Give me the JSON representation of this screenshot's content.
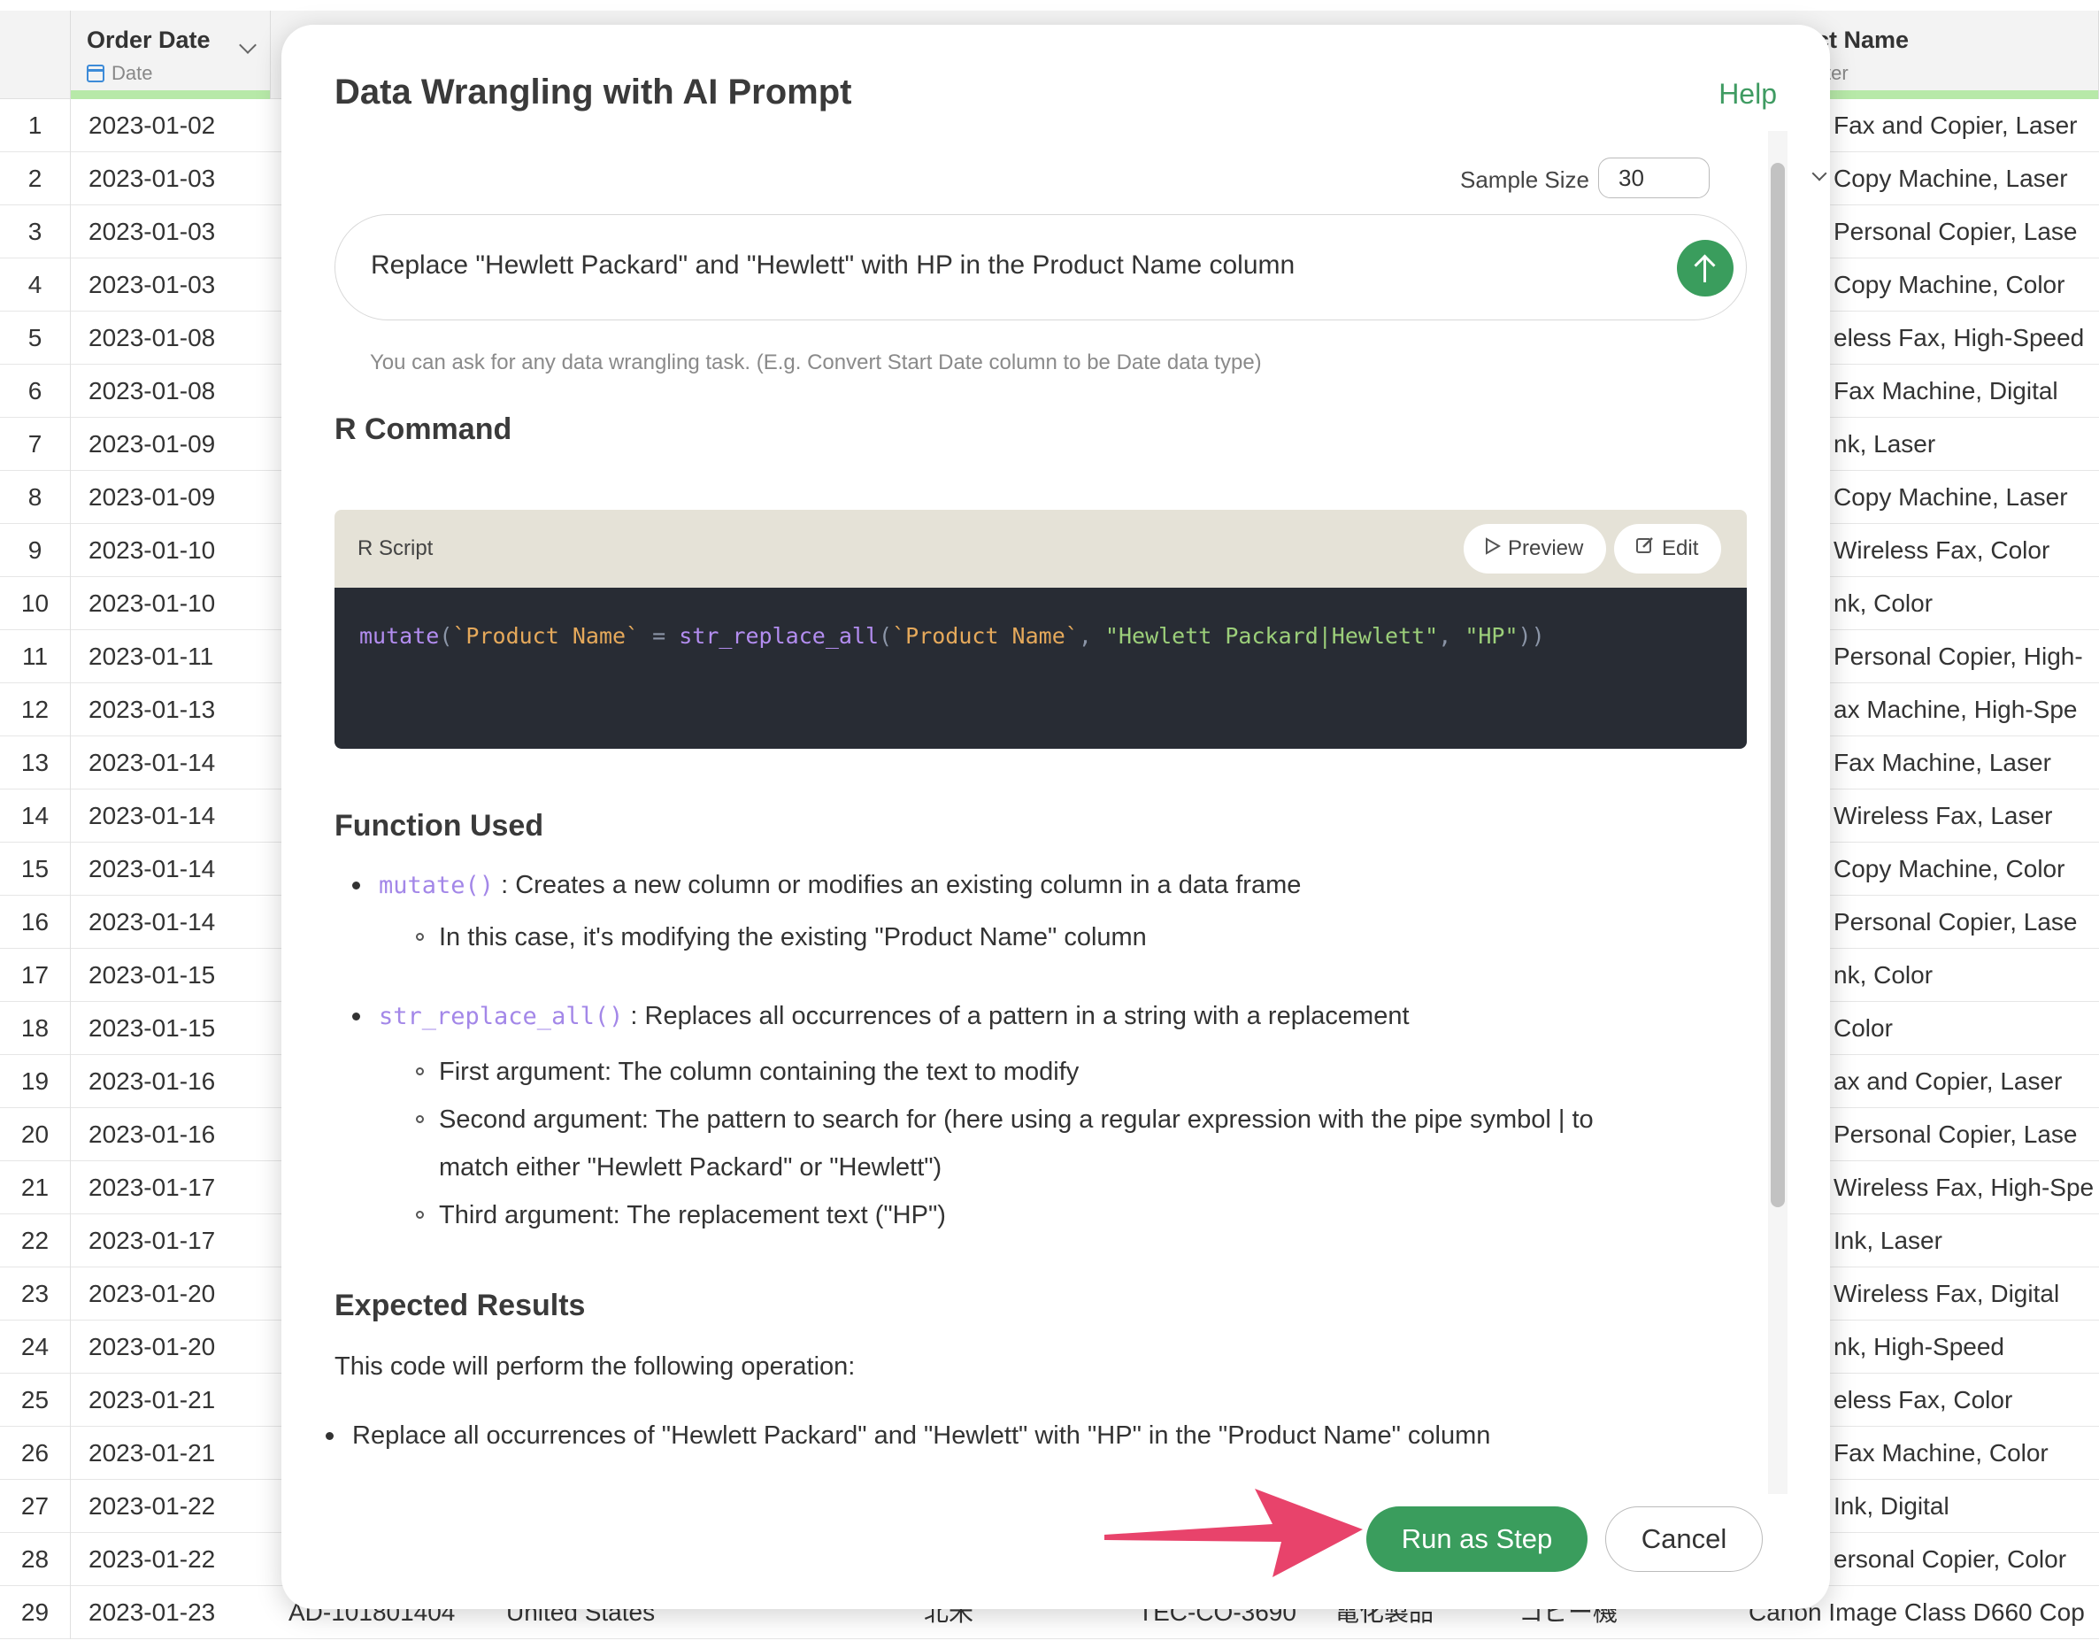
{
  "grid": {
    "columns": [
      {
        "title": "Order Date",
        "subtitle": "Date"
      },
      {
        "title": "ct Name",
        "subtitle": "cter"
      }
    ],
    "rows": [
      {
        "n": "1",
        "date": "2023-01-02",
        "product": "Fax and Copier, Laser"
      },
      {
        "n": "2",
        "date": "2023-01-03",
        "product": "Copy Machine, Laser"
      },
      {
        "n": "3",
        "date": "2023-01-03",
        "product": "Personal Copier, Lase"
      },
      {
        "n": "4",
        "date": "2023-01-03",
        "product": "Copy Machine, Color"
      },
      {
        "n": "5",
        "date": "2023-01-08",
        "product": "eless Fax, High-Speed"
      },
      {
        "n": "6",
        "date": "2023-01-08",
        "product": "Fax Machine, Digital"
      },
      {
        "n": "7",
        "date": "2023-01-09",
        "product": "nk, Laser"
      },
      {
        "n": "8",
        "date": "2023-01-09",
        "product": "Copy Machine, Laser"
      },
      {
        "n": "9",
        "date": "2023-01-10",
        "product": "Wireless Fax, Color"
      },
      {
        "n": "10",
        "date": "2023-01-10",
        "product": "nk, Color"
      },
      {
        "n": "11",
        "date": "2023-01-11",
        "product": "Personal Copier, High-"
      },
      {
        "n": "12",
        "date": "2023-01-13",
        "product": "ax Machine, High-Spe"
      },
      {
        "n": "13",
        "date": "2023-01-14",
        "product": "Fax Machine, Laser"
      },
      {
        "n": "14",
        "date": "2023-01-14",
        "product": "Wireless Fax, Laser"
      },
      {
        "n": "15",
        "date": "2023-01-14",
        "product": "Copy Machine, Color"
      },
      {
        "n": "16",
        "date": "2023-01-14",
        "product": "Personal Copier, Lase"
      },
      {
        "n": "17",
        "date": "2023-01-15",
        "product": "nk, Color"
      },
      {
        "n": "18",
        "date": "2023-01-15",
        "product": "Color"
      },
      {
        "n": "19",
        "date": "2023-01-16",
        "product": "ax and Copier, Laser"
      },
      {
        "n": "20",
        "date": "2023-01-16",
        "product": "Personal Copier, Lase"
      },
      {
        "n": "21",
        "date": "2023-01-17",
        "product": "Wireless Fax, High-Spe"
      },
      {
        "n": "22",
        "date": "2023-01-17",
        "product": "Ink, Laser"
      },
      {
        "n": "23",
        "date": "2023-01-20",
        "product": "Wireless Fax, Digital"
      },
      {
        "n": "24",
        "date": "2023-01-20",
        "product": "nk, High-Speed"
      },
      {
        "n": "25",
        "date": "2023-01-21",
        "product": "eless Fax, Color"
      },
      {
        "n": "26",
        "date": "2023-01-21",
        "product": "Fax Machine, Color"
      },
      {
        "n": "27",
        "date": "2023-01-22",
        "product": "Ink, Digital"
      },
      {
        "n": "28",
        "date": "2023-01-22",
        "product": "ersonal Copier, Color"
      }
    ],
    "last_row": {
      "n": "29",
      "date": "2023-01-23",
      "order_id": "AD-101801404",
      "country": "United States",
      "region": "北米",
      "product_id": "TEC-CO-3690",
      "category": "電化製品",
      "subcategory": "コピー機",
      "product": "Canon Image Class D660 Cop"
    }
  },
  "modal": {
    "title": "Data Wrangling with AI Prompt",
    "help": "Help",
    "sample_size_label": "Sample Size",
    "sample_size_value": "30",
    "prompt_text": "Replace \"Hewlett Packard\" and \"Hewlett\" with HP in the Product Name column",
    "hint": "You can ask for any data wrangling task. (E.g. Convert Start Date column to be Date data type)",
    "r_command_heading": "R Command",
    "script_label": "R Script",
    "preview_label": "Preview",
    "edit_label": "Edit",
    "code": {
      "fn1": "mutate",
      "p1": "(",
      "id1": "`Product Name`",
      "eq": " = ",
      "fn2": "str_replace_all",
      "p2": "(",
      "id2": "`Product Name`",
      "comma1": ", ",
      "str1": "\"Hewlett Packard|Hewlett\"",
      "comma2": ", ",
      "str2": "\"HP\"",
      "p3": "))"
    },
    "function_heading": "Function Used",
    "functions": [
      {
        "name": "mutate()",
        "desc": " : Creates a new column or modifies an existing column in a data frame",
        "subs": [
          "In this case, it's modifying the existing \"Product Name\" column"
        ]
      },
      {
        "name": "str_replace_all()",
        "desc": " : Replaces all occurrences of a pattern in a string with a replacement",
        "subs": [
          "First argument: The column containing the text to modify",
          "Second argument: The pattern to search for (here using a regular expression with the pipe symbol | to",
          "match either \"Hewlett Packard\" or \"Hewlett\")",
          "Third argument: The replacement text (\"HP\")"
        ]
      }
    ],
    "expected_heading": "Expected Results",
    "expected_para": "This code will perform the following operation:",
    "expected_bullet": "Replace all occurrences of \"Hewlett Packard\" and \"Hewlett\" with \"HP\" in the \"Product Name\" column",
    "run_button": "Run as Step",
    "cancel_button": "Cancel"
  },
  "colors": {
    "accent_green": "#3a9d5d",
    "arrow_pink": "#e8436b",
    "code_bg": "#282c34"
  }
}
